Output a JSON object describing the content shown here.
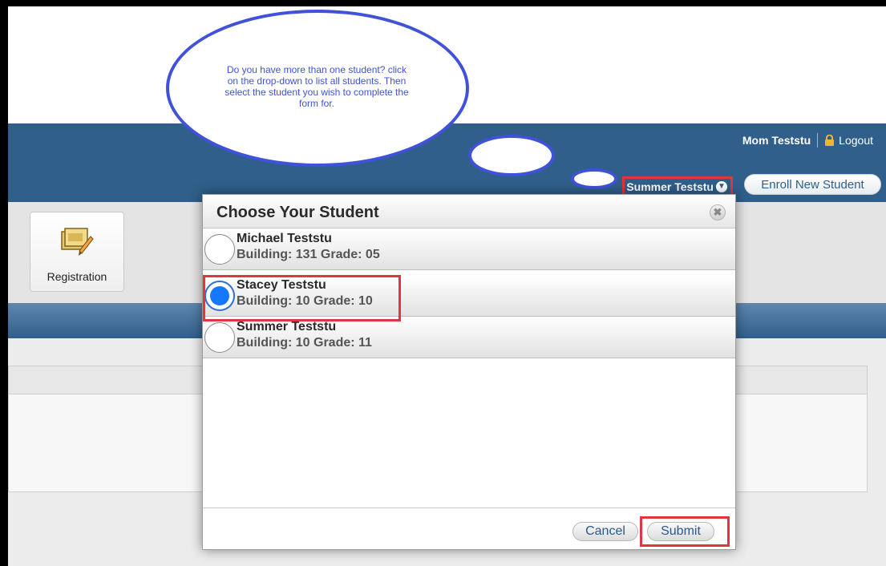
{
  "callout": {
    "text": "Do you have more than one student? click on the drop-down to list all students. Then select the student you wish to complete the form for."
  },
  "header": {
    "user_name": "Mom Teststu",
    "logout_label": "Logout",
    "current_student": "Summer Teststu",
    "enroll_label": "Enroll New Student"
  },
  "nav": {
    "tiles": [
      {
        "label": "Registration",
        "icon": "registration-icon"
      }
    ]
  },
  "modal": {
    "title": "Choose Your Student",
    "students": [
      {
        "name": "Michael Teststu",
        "info": "Building: 131 Grade: 05",
        "selected": false
      },
      {
        "name": "Stacey Teststu",
        "info": "Building: 10 Grade: 10",
        "selected": true
      },
      {
        "name": "Summer Teststu",
        "info": "Building: 10 Grade: 11",
        "selected": false
      }
    ],
    "cancel_label": "Cancel",
    "submit_label": "Submit"
  },
  "colors": {
    "header_blue": "#2f5f8a",
    "highlight_red": "#e0373e",
    "callout_blue": "#3f52d9",
    "radio_selected": "#1677ff"
  }
}
